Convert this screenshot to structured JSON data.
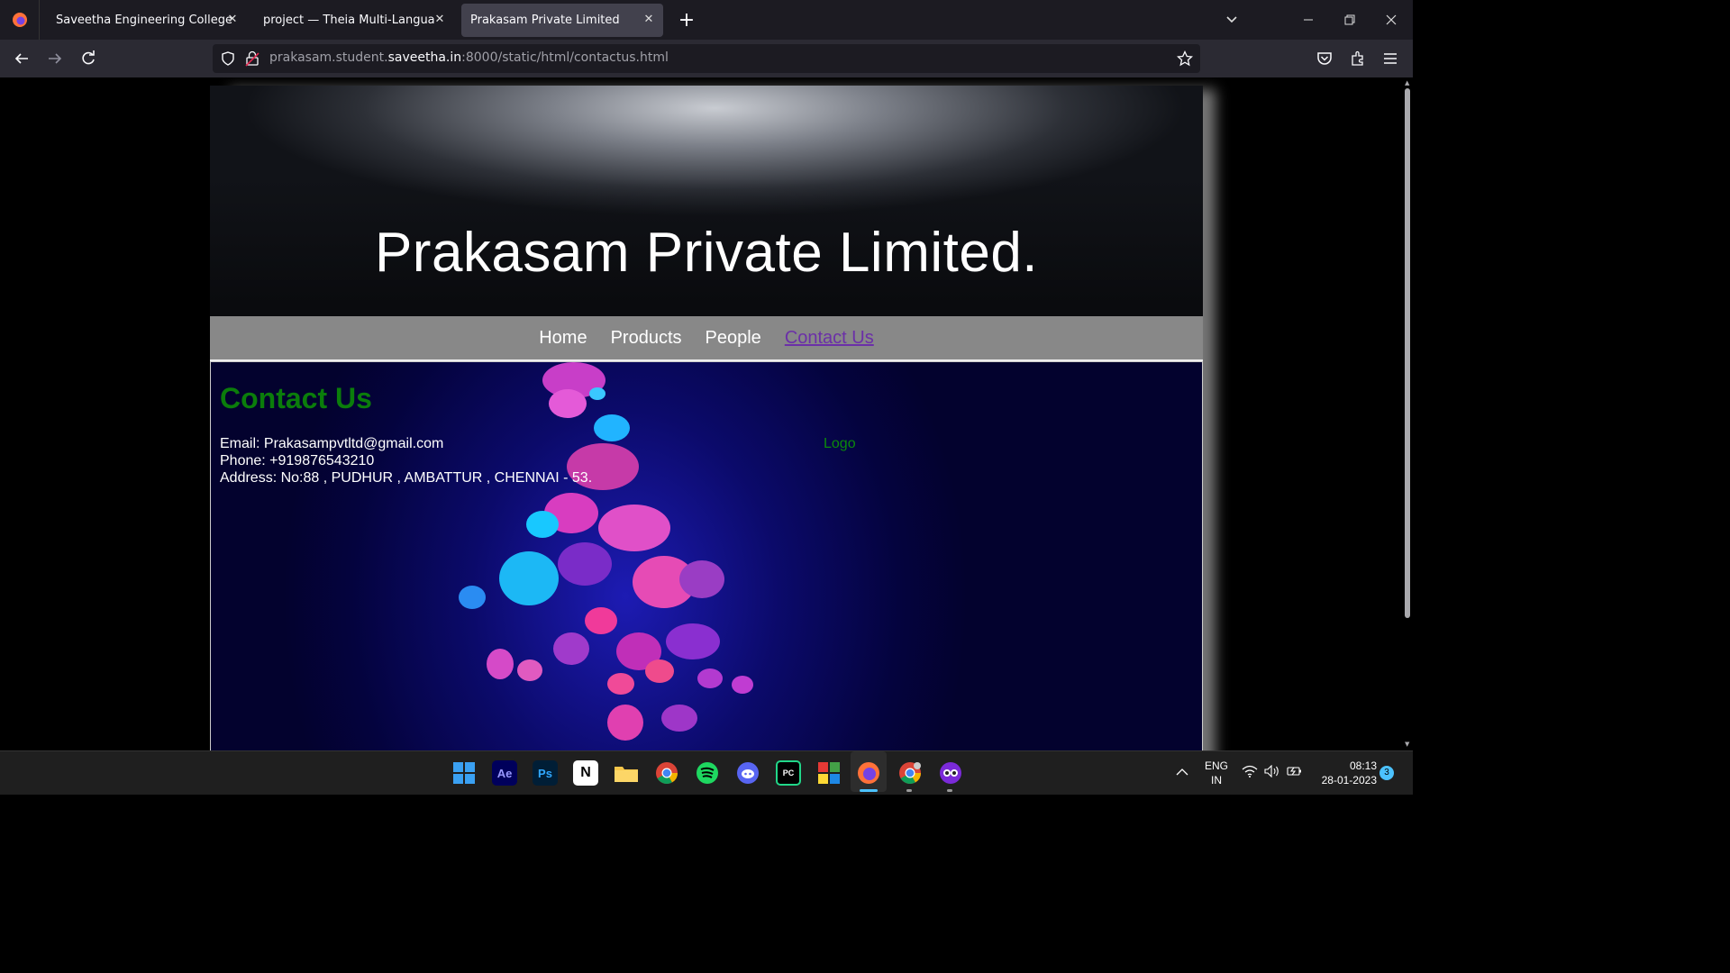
{
  "browser": {
    "tabs": [
      {
        "label": "Saveetha Engineering College"
      },
      {
        "label": "project — Theia Multi-Language Ex"
      },
      {
        "label": "Prakasam Private Limited"
      }
    ],
    "url_prefix": "prakasam.student.",
    "url_domain": "saveetha.in",
    "url_suffix": ":8000/static/html/contactus.html"
  },
  "page": {
    "title": "Prakasam Private Limited.",
    "nav": [
      "Home",
      "Products",
      "People",
      "Contact Us"
    ],
    "heading": "Contact Us",
    "email": "Email: Prakasampvtltd@gmail.com",
    "phone": "Phone: +919876543210",
    "address": "Address: No:88 , PUDHUR , AMBATTUR , CHENNAI - 53.",
    "logo_alt": "Logo"
  },
  "taskbar": {
    "lang_top": "ENG",
    "lang_bottom": "IN",
    "time": "08:13",
    "date": "28-01-2023",
    "notifications": "3",
    "apps": [
      "windows-start",
      "after-effects",
      "photoshop",
      "notion",
      "file-explorer",
      "chrome",
      "spotify",
      "discord",
      "pycharm",
      "app-grid",
      "firefox",
      "chrome-profile",
      "cheat-engine"
    ]
  },
  "colors": {
    "heading_green": "#0b7d0b",
    "link_visited": "#6b2fa8",
    "menu_bg": "#888888",
    "content_bg": "#04033e"
  }
}
